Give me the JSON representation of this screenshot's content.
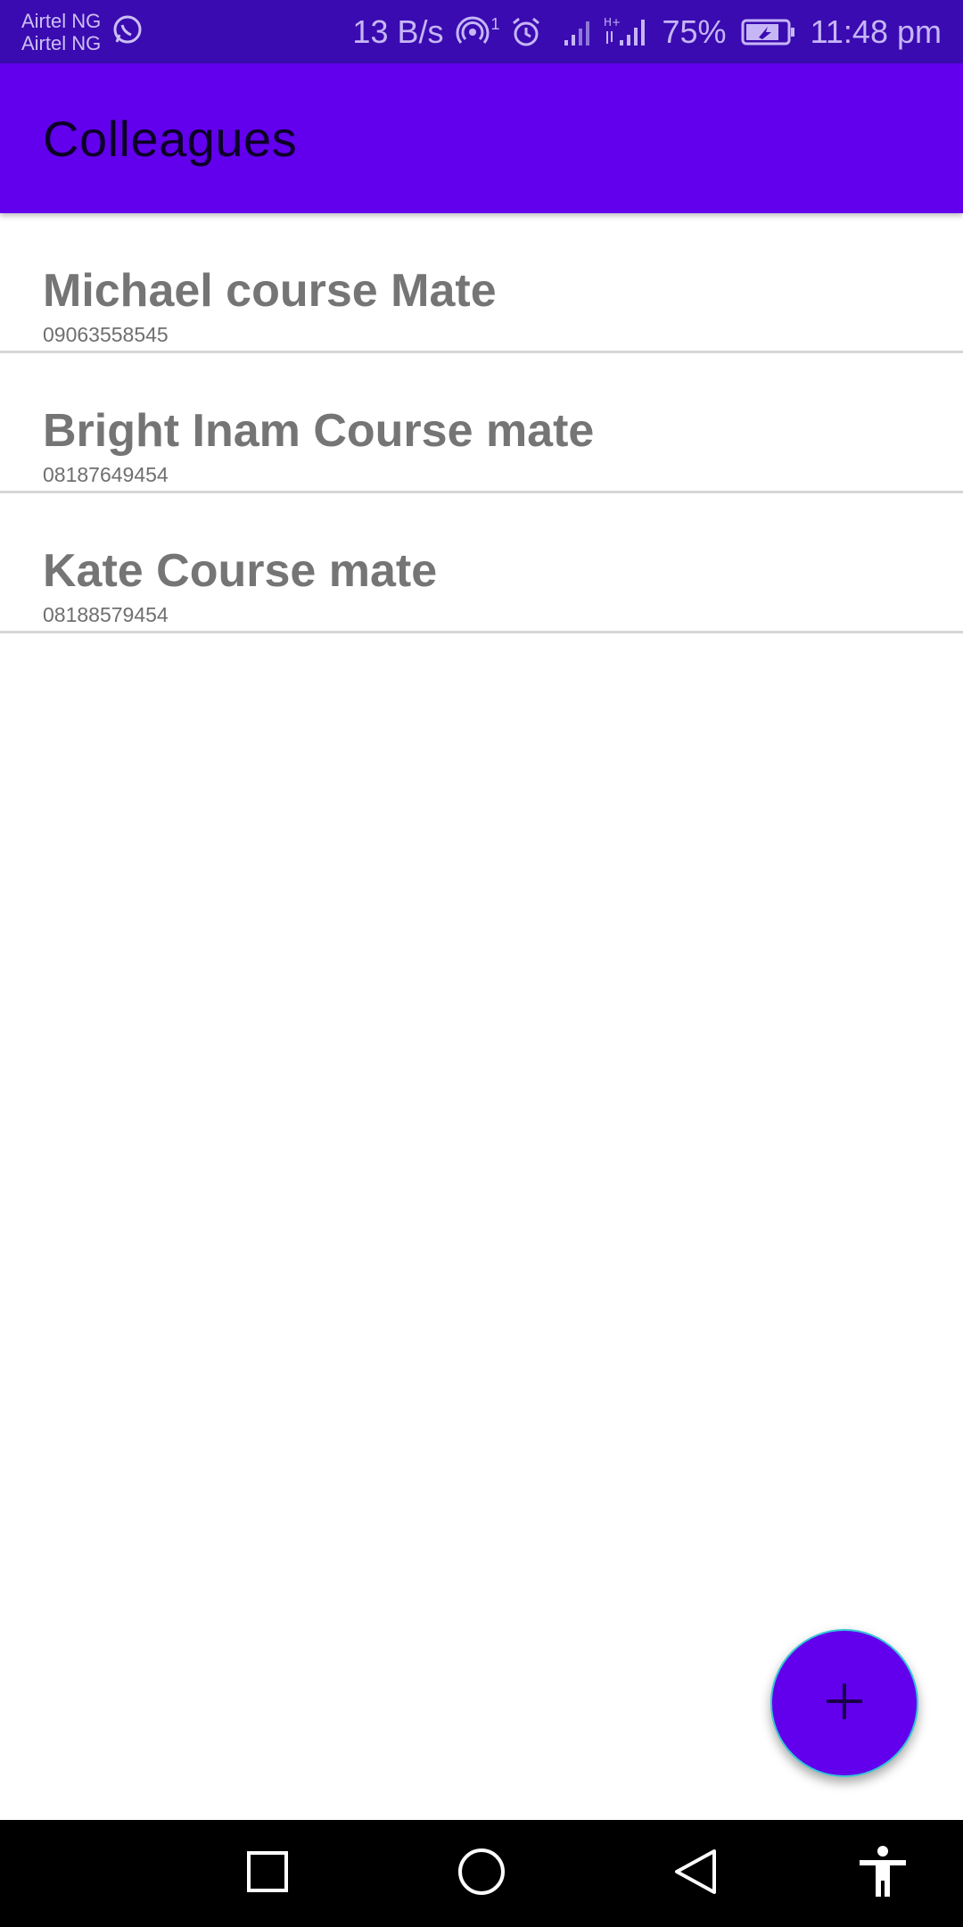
{
  "status_bar": {
    "carrier_1": "Airtel NG",
    "carrier_2": "Airtel NG",
    "net_speed": "13 B/s",
    "hotspot_badge": "1",
    "battery_percent": "75%",
    "time": "11:48 pm",
    "icons": [
      "whatsapp-icon",
      "hotspot-icon",
      "alarm-icon",
      "signal-icon",
      "hplus-signal-icon",
      "battery-icon"
    ]
  },
  "app_bar": {
    "title": "Colleagues"
  },
  "contacts": [
    {
      "name": "Michael course Mate",
      "phone": "09063558545"
    },
    {
      "name": "Bright Inam Course mate",
      "phone": "08187649454"
    },
    {
      "name": "Kate Course mate",
      "phone": "08188579454"
    }
  ],
  "fab": {
    "icon": "add-icon"
  },
  "nav_bar": {
    "icons": [
      "recents-square-icon",
      "home-circle-icon",
      "back-triangle-icon",
      "accessibility-icon"
    ]
  },
  "colors": {
    "primary": "#6200ee",
    "status_bar": "#3a0bb0",
    "text_secondary": "#757575",
    "divider": "#d6d6d6",
    "fab_outline": "#34c6d4"
  }
}
